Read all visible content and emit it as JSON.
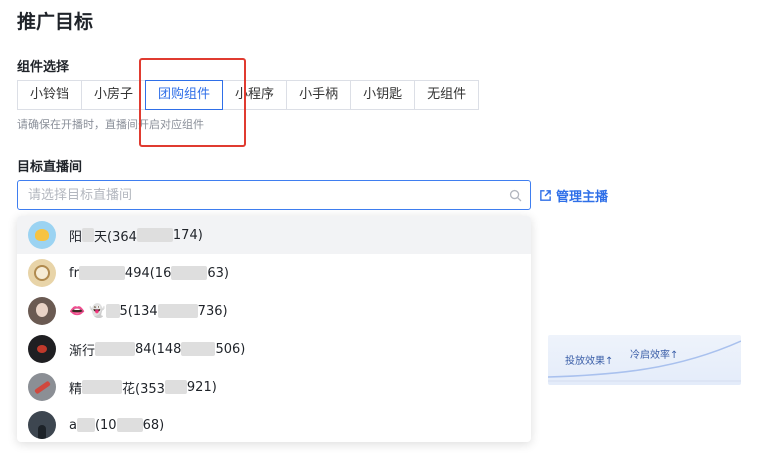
{
  "page": {
    "title": "推广目标"
  },
  "component": {
    "label": "组件选择",
    "options": [
      {
        "label": "小铃铛",
        "active": false
      },
      {
        "label": "小房子",
        "active": false
      },
      {
        "label": "团购组件",
        "active": true
      },
      {
        "label": "小程序",
        "active": false
      },
      {
        "label": "小手柄",
        "active": false
      },
      {
        "label": "小钥匙",
        "active": false
      },
      {
        "label": "无组件",
        "active": false
      }
    ],
    "hint": "请确保在开播时，直播间开启对应组件"
  },
  "room": {
    "label": "目标直播间",
    "search_placeholder": "请选择目标直播间",
    "manage_label": "管理主播"
  },
  "dropdown": {
    "items": [
      {
        "pre": "阳",
        "post": "天(364",
        "tail": "174)"
      },
      {
        "pre": "fr",
        "post": "494(16",
        "tail": "63)"
      },
      {
        "pre": "👄 👻",
        "post": "5(134",
        "tail": "736)"
      },
      {
        "pre": "渐行",
        "post": "84(148",
        "tail": "506)"
      },
      {
        "pre": "精",
        "post": "花(353",
        "tail": "921)"
      },
      {
        "pre": "a",
        "post": "(10",
        "tail": "68)"
      }
    ]
  },
  "preview": {
    "tag1": "投放效果↑",
    "tag2": "冷启效率↑"
  },
  "colors": {
    "accent": "#2f6fe8",
    "highlight": "#e03b30"
  }
}
